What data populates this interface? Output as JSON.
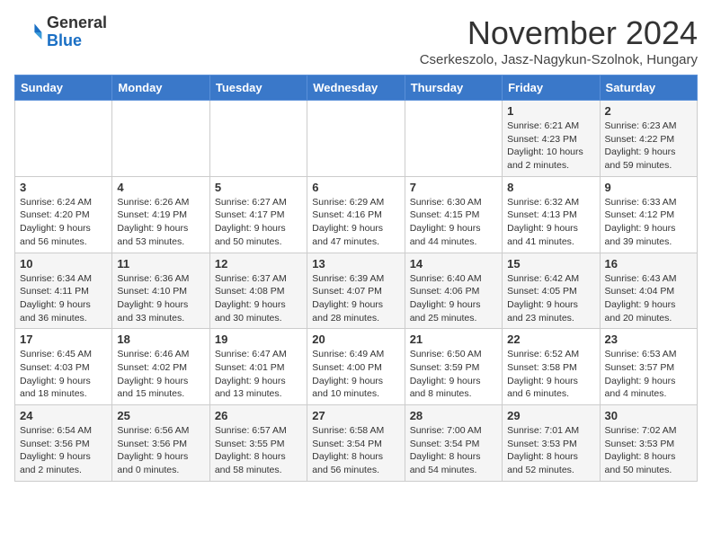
{
  "header": {
    "logo_general": "General",
    "logo_blue": "Blue",
    "title": "November 2024",
    "subtitle": "Cserkeszolo, Jasz-Nagykun-Szolnok, Hungary"
  },
  "weekdays": [
    "Sunday",
    "Monday",
    "Tuesday",
    "Wednesday",
    "Thursday",
    "Friday",
    "Saturday"
  ],
  "weeks": [
    [
      {
        "day": "",
        "info": ""
      },
      {
        "day": "",
        "info": ""
      },
      {
        "day": "",
        "info": ""
      },
      {
        "day": "",
        "info": ""
      },
      {
        "day": "",
        "info": ""
      },
      {
        "day": "1",
        "info": "Sunrise: 6:21 AM\nSunset: 4:23 PM\nDaylight: 10 hours\nand 2 minutes."
      },
      {
        "day": "2",
        "info": "Sunrise: 6:23 AM\nSunset: 4:22 PM\nDaylight: 9 hours\nand 59 minutes."
      }
    ],
    [
      {
        "day": "3",
        "info": "Sunrise: 6:24 AM\nSunset: 4:20 PM\nDaylight: 9 hours\nand 56 minutes."
      },
      {
        "day": "4",
        "info": "Sunrise: 6:26 AM\nSunset: 4:19 PM\nDaylight: 9 hours\nand 53 minutes."
      },
      {
        "day": "5",
        "info": "Sunrise: 6:27 AM\nSunset: 4:17 PM\nDaylight: 9 hours\nand 50 minutes."
      },
      {
        "day": "6",
        "info": "Sunrise: 6:29 AM\nSunset: 4:16 PM\nDaylight: 9 hours\nand 47 minutes."
      },
      {
        "day": "7",
        "info": "Sunrise: 6:30 AM\nSunset: 4:15 PM\nDaylight: 9 hours\nand 44 minutes."
      },
      {
        "day": "8",
        "info": "Sunrise: 6:32 AM\nSunset: 4:13 PM\nDaylight: 9 hours\nand 41 minutes."
      },
      {
        "day": "9",
        "info": "Sunrise: 6:33 AM\nSunset: 4:12 PM\nDaylight: 9 hours\nand 39 minutes."
      }
    ],
    [
      {
        "day": "10",
        "info": "Sunrise: 6:34 AM\nSunset: 4:11 PM\nDaylight: 9 hours\nand 36 minutes."
      },
      {
        "day": "11",
        "info": "Sunrise: 6:36 AM\nSunset: 4:10 PM\nDaylight: 9 hours\nand 33 minutes."
      },
      {
        "day": "12",
        "info": "Sunrise: 6:37 AM\nSunset: 4:08 PM\nDaylight: 9 hours\nand 30 minutes."
      },
      {
        "day": "13",
        "info": "Sunrise: 6:39 AM\nSunset: 4:07 PM\nDaylight: 9 hours\nand 28 minutes."
      },
      {
        "day": "14",
        "info": "Sunrise: 6:40 AM\nSunset: 4:06 PM\nDaylight: 9 hours\nand 25 minutes."
      },
      {
        "day": "15",
        "info": "Sunrise: 6:42 AM\nSunset: 4:05 PM\nDaylight: 9 hours\nand 23 minutes."
      },
      {
        "day": "16",
        "info": "Sunrise: 6:43 AM\nSunset: 4:04 PM\nDaylight: 9 hours\nand 20 minutes."
      }
    ],
    [
      {
        "day": "17",
        "info": "Sunrise: 6:45 AM\nSunset: 4:03 PM\nDaylight: 9 hours\nand 18 minutes."
      },
      {
        "day": "18",
        "info": "Sunrise: 6:46 AM\nSunset: 4:02 PM\nDaylight: 9 hours\nand 15 minutes."
      },
      {
        "day": "19",
        "info": "Sunrise: 6:47 AM\nSunset: 4:01 PM\nDaylight: 9 hours\nand 13 minutes."
      },
      {
        "day": "20",
        "info": "Sunrise: 6:49 AM\nSunset: 4:00 PM\nDaylight: 9 hours\nand 10 minutes."
      },
      {
        "day": "21",
        "info": "Sunrise: 6:50 AM\nSunset: 3:59 PM\nDaylight: 9 hours\nand 8 minutes."
      },
      {
        "day": "22",
        "info": "Sunrise: 6:52 AM\nSunset: 3:58 PM\nDaylight: 9 hours\nand 6 minutes."
      },
      {
        "day": "23",
        "info": "Sunrise: 6:53 AM\nSunset: 3:57 PM\nDaylight: 9 hours\nand 4 minutes."
      }
    ],
    [
      {
        "day": "24",
        "info": "Sunrise: 6:54 AM\nSunset: 3:56 PM\nDaylight: 9 hours\nand 2 minutes."
      },
      {
        "day": "25",
        "info": "Sunrise: 6:56 AM\nSunset: 3:56 PM\nDaylight: 9 hours\nand 0 minutes."
      },
      {
        "day": "26",
        "info": "Sunrise: 6:57 AM\nSunset: 3:55 PM\nDaylight: 8 hours\nand 58 minutes."
      },
      {
        "day": "27",
        "info": "Sunrise: 6:58 AM\nSunset: 3:54 PM\nDaylight: 8 hours\nand 56 minutes."
      },
      {
        "day": "28",
        "info": "Sunrise: 7:00 AM\nSunset: 3:54 PM\nDaylight: 8 hours\nand 54 minutes."
      },
      {
        "day": "29",
        "info": "Sunrise: 7:01 AM\nSunset: 3:53 PM\nDaylight: 8 hours\nand 52 minutes."
      },
      {
        "day": "30",
        "info": "Sunrise: 7:02 AM\nSunset: 3:53 PM\nDaylight: 8 hours\nand 50 minutes."
      }
    ]
  ]
}
